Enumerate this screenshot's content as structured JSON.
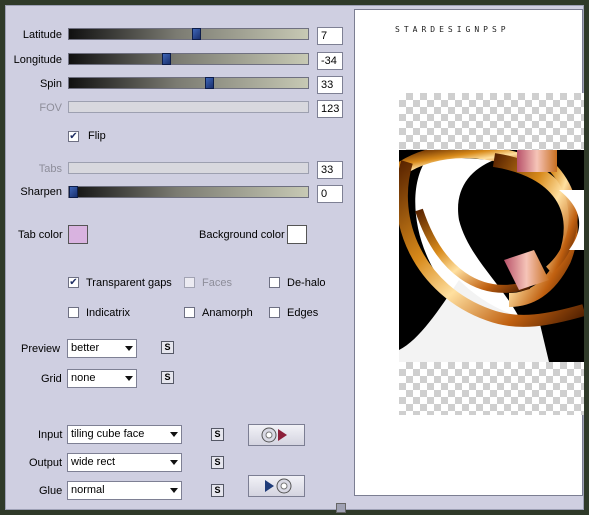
{
  "controls": {
    "latitude": {
      "label": "Latitude",
      "value": "7",
      "level": 0.53
    },
    "longitude": {
      "label": "Longitude",
      "value": "-34",
      "level": 0.4
    },
    "spin": {
      "label": "Spin",
      "value": "33",
      "level": 0.58
    },
    "fov": {
      "label": "FOV",
      "value": "123"
    },
    "flip": {
      "label": "Flip",
      "checked": true
    },
    "tabs": {
      "label": "Tabs",
      "value": "33"
    },
    "sharpen": {
      "label": "Sharpen",
      "value": "0",
      "level": 0.0
    }
  },
  "colors": {
    "tab_color_label": "Tab color",
    "tab_color": "#d9b3e0",
    "background_color_label": "Background color",
    "background_color": "#ffffff"
  },
  "options": {
    "transparent_gaps": {
      "label": "Transparent gaps",
      "checked": true
    },
    "faces": {
      "label": "Faces",
      "checked": false
    },
    "de_halo": {
      "label": "De-halo",
      "checked": false
    },
    "indicatrix": {
      "label": "Indicatrix",
      "checked": false
    },
    "anamorph": {
      "label": "Anamorph",
      "checked": false
    },
    "edges": {
      "label": "Edges",
      "checked": false
    }
  },
  "dropdowns": {
    "preview": {
      "label": "Preview",
      "value": "better"
    },
    "grid": {
      "label": "Grid",
      "value": "none"
    },
    "input": {
      "label": "Input",
      "value": "tiling cube face"
    },
    "output": {
      "label": "Output",
      "value": "wide rect"
    },
    "glue": {
      "label": "Glue",
      "value": "normal"
    }
  },
  "icons": {
    "s_button": "S",
    "check": "✔",
    "swap_right": "disc-to-arrow-icon",
    "swap_left": "arrow-to-disc-icon"
  },
  "preview": {
    "watermark": "STARDESIGNPSP"
  }
}
